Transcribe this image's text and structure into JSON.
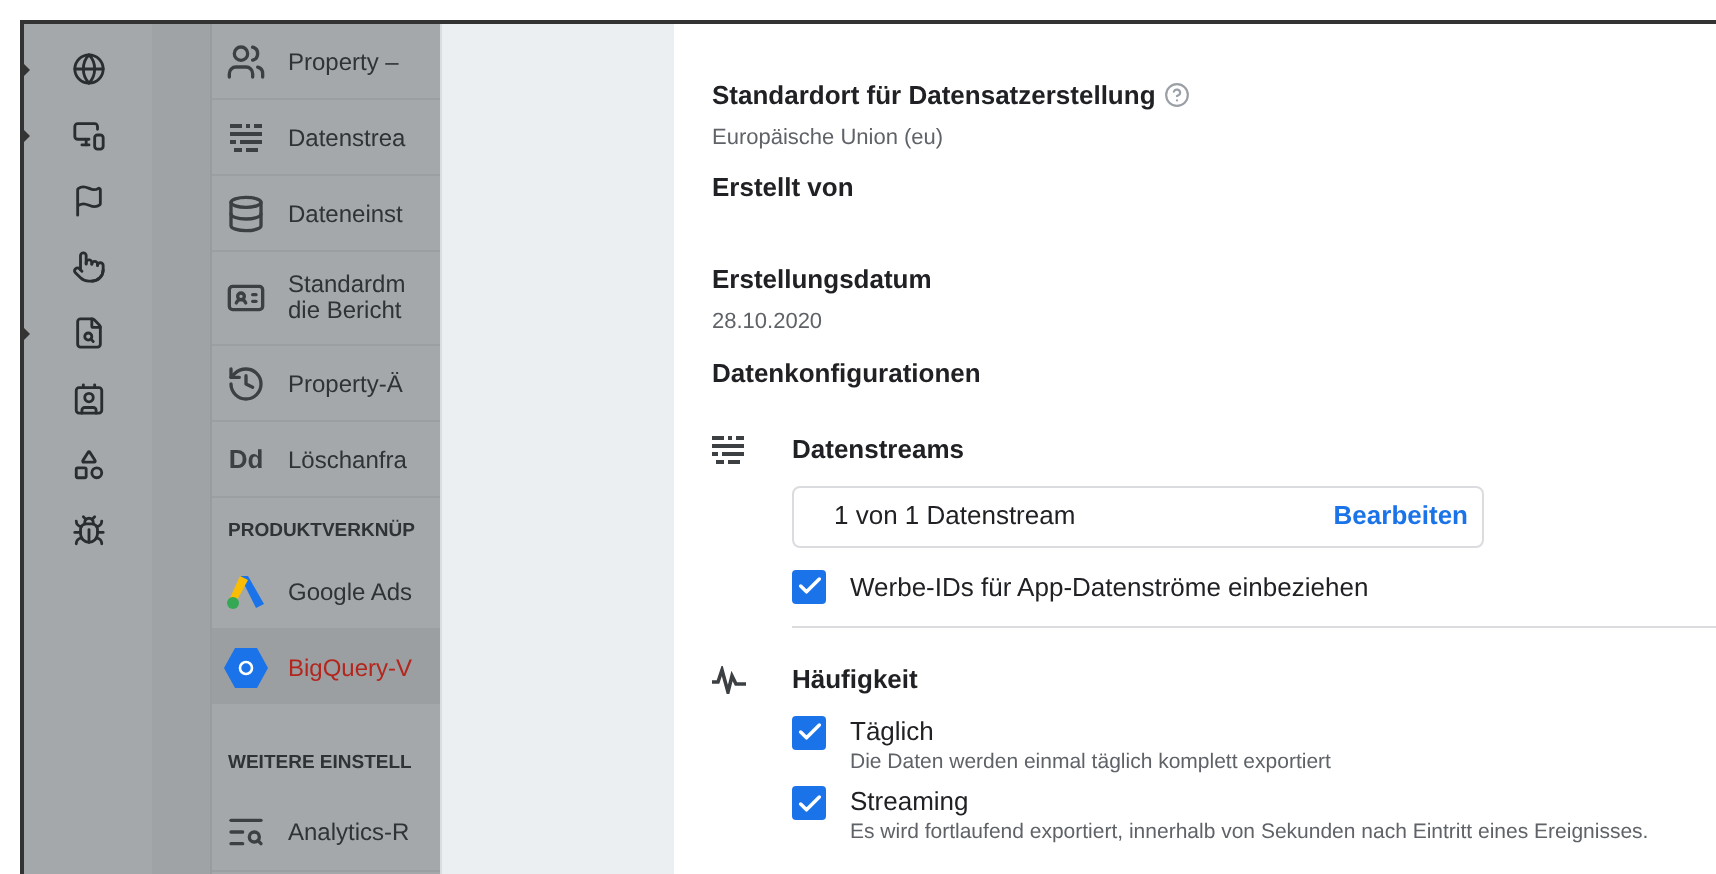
{
  "rail": [
    {
      "expandable": true
    },
    {
      "expandable": true
    },
    {
      "expandable": false
    },
    {
      "expandable": false
    },
    {
      "expandable": true
    },
    {
      "expandable": false
    },
    {
      "expandable": false
    },
    {
      "expandable": false
    }
  ],
  "nav": [
    {
      "kind": "item",
      "label": "Property –",
      "selected": false
    },
    {
      "kind": "item",
      "label": "Datenstrea",
      "selected": false
    },
    {
      "kind": "item",
      "label": "Dateneinst",
      "selected": false
    },
    {
      "kind": "item2",
      "label": "Standardm",
      "label2": "die Bericht",
      "selected": false
    },
    {
      "kind": "item",
      "label": "Property-Ä",
      "selected": false
    },
    {
      "kind": "item",
      "icon_text": "Dd",
      "label": "Löschanfra",
      "selected": false
    },
    {
      "kind": "header",
      "label": "PRODUKTVERKNÜP"
    },
    {
      "kind": "item",
      "label": "Google Ads",
      "selected": false
    },
    {
      "kind": "item",
      "label": "BigQuery-V",
      "selected": true
    },
    {
      "kind": "header",
      "label": "WEITERE EINSTELL"
    },
    {
      "kind": "item",
      "label": "Analytics-R",
      "selected": false
    }
  ],
  "details": [
    {
      "label": "Standardort für Datensatzerstellung",
      "help": true,
      "value": "Europäische Union (eu)"
    },
    {
      "label": "Erstellt von",
      "help": false
    },
    {
      "label": "Erstellungsdatum",
      "help": false,
      "value": "28.10.2020"
    }
  ],
  "config_title": "Datenkonfigurationen",
  "streams": {
    "title": "Datenstreams",
    "summary": "1 von 1 Datenstream",
    "edit": "Bearbeiten",
    "ad_ids": {
      "label": "Werbe-IDs für App-Datenströme einbeziehen",
      "checked": true
    }
  },
  "frequency": {
    "title": "Häufigkeit",
    "options": [
      {
        "label": "Täglich",
        "description": "Die Daten werden einmal täglich komplett exportiert",
        "checked": true
      },
      {
        "label": "Streaming",
        "description": "Es wird fortlaufend exportiert, innerhalb von Sekunden nach Eintritt eines Ereignisses.",
        "checked": true
      }
    ]
  }
}
